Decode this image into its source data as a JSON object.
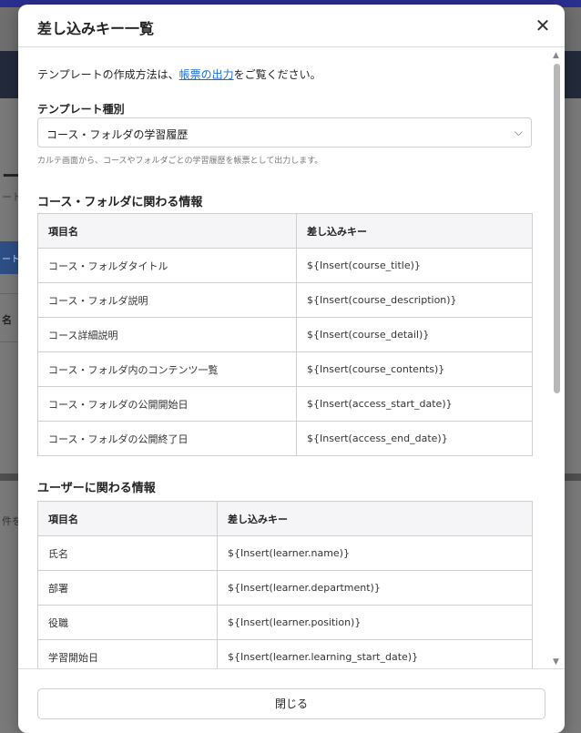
{
  "background": {
    "fragments": [
      "ー",
      "ート",
      "ート",
      "名",
      "件を"
    ]
  },
  "modal": {
    "title": "差し込みキー一覧",
    "close_icon": "close-icon",
    "intro_prefix": "テンプレートの作成方法は、",
    "intro_link": "帳票の出力",
    "intro_suffix": "をご覧ください。",
    "template_type": {
      "label": "テンプレート種別",
      "value": "コース・フォルダの学習履歴",
      "helper": "カルテ画面から、コースやフォルダごとの学習履歴を帳票として出力します。"
    },
    "sections": [
      {
        "title": "コース・フォルダに関わる情報",
        "headers": [
          "項目名",
          "差し込みキー"
        ],
        "rows": [
          [
            "コース・フォルダタイトル",
            "${Insert(course_title)}"
          ],
          [
            "コース・フォルダ説明",
            "${Insert(course_description)}"
          ],
          [
            "コース詳細説明",
            "${Insert(course_detail)}"
          ],
          [
            "コース・フォルダ内のコンテンツ一覧",
            "${Insert(course_contents)}"
          ],
          [
            "コース・フォルダの公開開始日",
            "${Insert(access_start_date)}"
          ],
          [
            "コース・フォルダの公開終了日",
            "${Insert(access_end_date)}"
          ]
        ]
      },
      {
        "title": "ユーザーに関わる情報",
        "headers": [
          "項目名",
          "差し込みキー"
        ],
        "rows": [
          [
            "氏名",
            "${Insert(learner.name)}"
          ],
          [
            "部署",
            "${Insert(learner.department)}"
          ],
          [
            "役職",
            "${Insert(learner.position)}"
          ],
          [
            "学習開始日",
            "${Insert(learner.learning_start_date)}"
          ]
        ]
      }
    ],
    "footer": {
      "close_label": "閉じる"
    }
  }
}
